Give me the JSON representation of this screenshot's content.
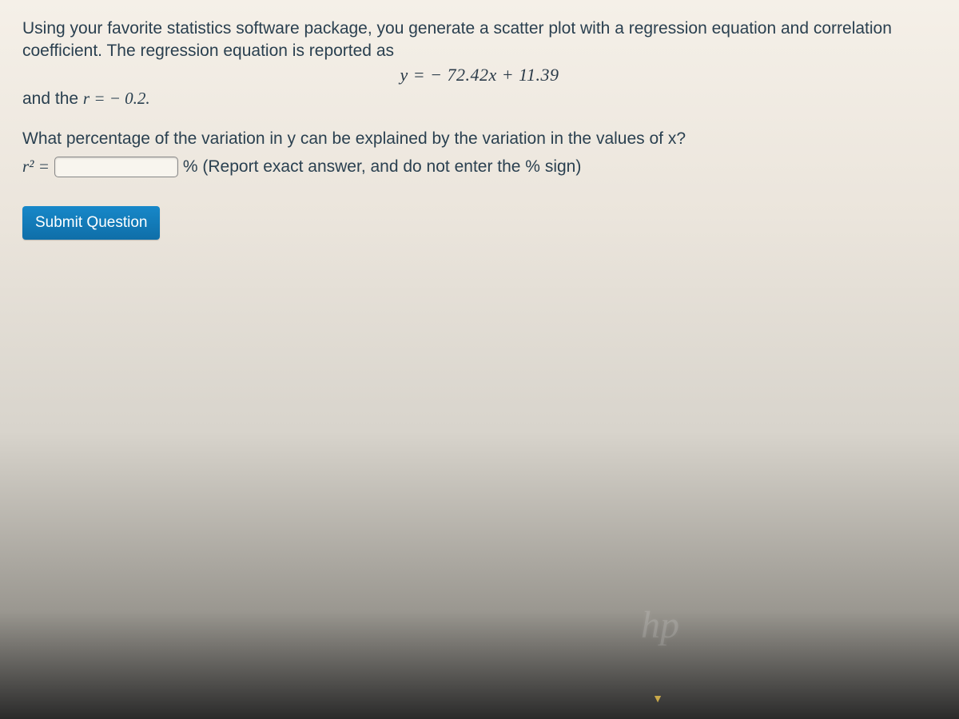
{
  "prompt": {
    "line1": "Using your favorite statistics software package, you generate a scatter plot with a regression equation and correlation coefficient. The regression equation is reported as",
    "equation": "y = − 72.42x + 11.39",
    "line2_prefix": "and the ",
    "r_expr": "r = − 0.2.",
    "question": "What percentage of the variation in y can be explained by the variation in the values of x?",
    "answer_label": "r² =",
    "answer_hint_suffix": "% (Report exact answer, and do not enter the % sign)"
  },
  "submit": {
    "label": "Submit Question"
  },
  "watermark": "hp"
}
